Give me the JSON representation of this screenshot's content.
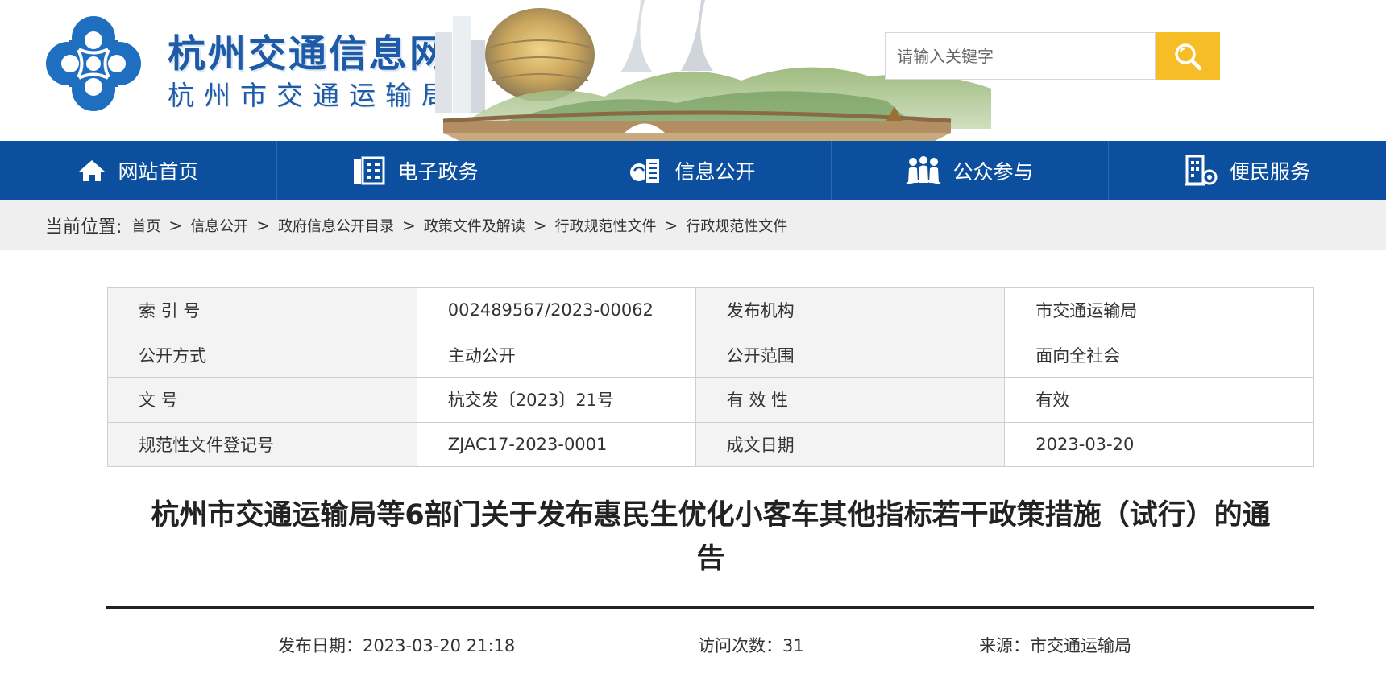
{
  "site": {
    "title": "杭州交通信息网",
    "subtitle": "杭州市交通运输局"
  },
  "search": {
    "placeholder": "请输入关键字"
  },
  "nav": [
    {
      "label": "网站首页",
      "icon": "home-icon"
    },
    {
      "label": "电子政务",
      "icon": "building-icon"
    },
    {
      "label": "信息公开",
      "icon": "document-icon"
    },
    {
      "label": "公众参与",
      "icon": "people-icon"
    },
    {
      "label": "便民服务",
      "icon": "service-icon"
    }
  ],
  "breadcrumb": {
    "label": "当前位置:",
    "items": [
      "首页",
      "信息公开",
      "政府信息公开目录",
      "政策文件及解读",
      "行政规范性文件",
      "行政规范性文件"
    ]
  },
  "meta": {
    "rows": [
      [
        "索 引 号",
        "002489567/2023-00062",
        "发布机构",
        "市交通运输局"
      ],
      [
        "公开方式",
        "主动公开",
        "公开范围",
        "面向全社会"
      ],
      [
        "文 号",
        "杭交发〔2023〕21号",
        "有 效 性",
        "有效"
      ],
      [
        "规范性文件登记号",
        "ZJAC17-2023-0001",
        "成文日期",
        "2023-03-20"
      ]
    ]
  },
  "article": {
    "title": "杭州市交通运输局等6部门关于发布惠民生优化小客车其他指标若干政策措施（试行）的通告",
    "publish_date": "发布日期：2023-03-20 21:18",
    "visits": "访问次数：31",
    "source": "来源：市交通运输局"
  },
  "colors": {
    "nav_bg": "#0c4f9e",
    "brand_blue": "#1e5aa6",
    "search_button": "#f6bd27"
  }
}
